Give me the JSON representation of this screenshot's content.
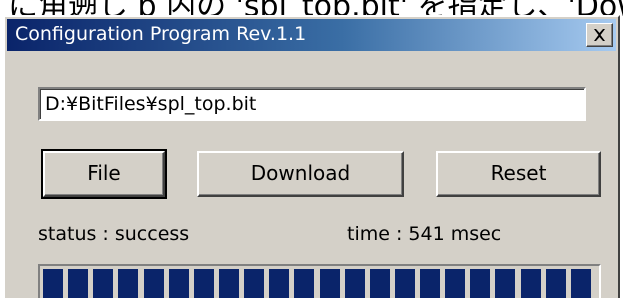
{
  "header_crop": {
    "text": "に角遡し b 内の 'spl_top.bit' を指定し、'Downlo"
  },
  "window": {
    "title": "Configuration Program  Rev.1.1",
    "close_icon": "close-icon"
  },
  "path_field": {
    "value": "D:¥BitFiles¥spl_top.bit"
  },
  "buttons": {
    "file_label": "File",
    "download_label": "Download",
    "reset_label": "Reset"
  },
  "status": {
    "status_text": "status : success",
    "time_text": "time : 541  msec"
  },
  "progress": {
    "percent": 100,
    "segment_count": 22,
    "fill_color": "#0a246a"
  },
  "colors": {
    "face": "#d4d0c8",
    "title_start": "#0a246a",
    "title_end": "#a6caf0"
  }
}
